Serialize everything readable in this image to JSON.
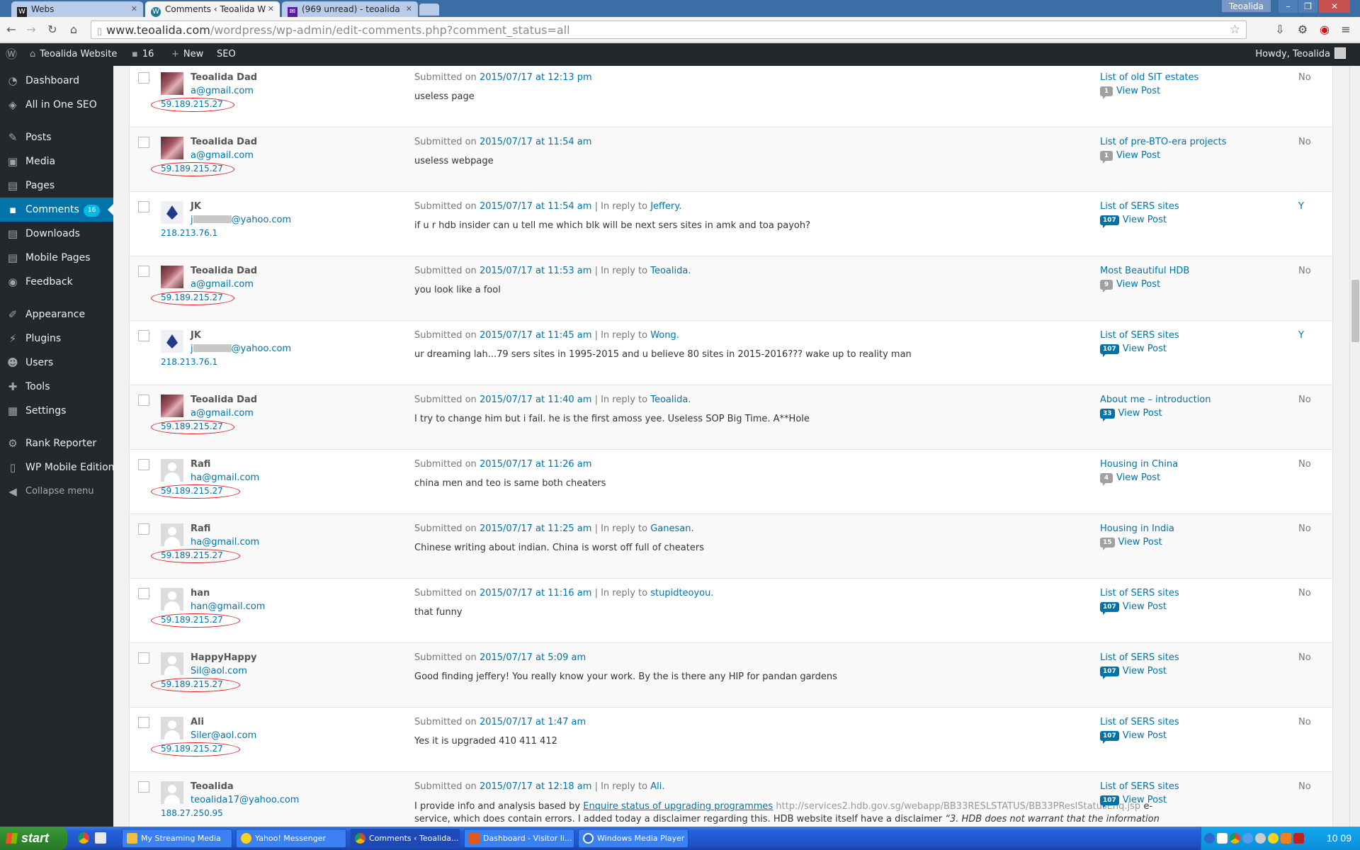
{
  "browser": {
    "tabs": [
      {
        "title": "Webs",
        "icon": "W"
      },
      {
        "title": "Comments ‹ Teoalida W",
        "icon": "wp"
      },
      {
        "title": "(969 unread) - teoalida",
        "icon": "yahoo"
      }
    ],
    "window_user": "Teoalida",
    "url_host": "www.teoalida.com",
    "url_path": "/wordpress/wp-admin/edit-comments.php?comment_status=all"
  },
  "adminbar": {
    "site_name": "Teoalida Website",
    "comments_count": "16",
    "new_label": "New",
    "seo_label": "SEO",
    "howdy": "Howdy, Teoalida"
  },
  "menu": {
    "dashboard": "Dashboard",
    "aioseo": "All in One SEO",
    "posts": "Posts",
    "media": "Media",
    "pages": "Pages",
    "comments": "Comments",
    "comments_badge": "16",
    "downloads": "Downloads",
    "mobile_pages": "Mobile Pages",
    "feedback": "Feedback",
    "appearance": "Appearance",
    "plugins": "Plugins",
    "users": "Users",
    "tools": "Tools",
    "settings": "Settings",
    "rank_reporter": "Rank Reporter",
    "wp_mobile": "WP Mobile Edition",
    "collapse": "Collapse menu"
  },
  "labels": {
    "submitted_on": "Submitted on",
    "in_reply_to": "| In reply to",
    "view_post": "View Post"
  },
  "comments": [
    {
      "author": "Teoalida Dad",
      "email": "a@gmail.com",
      "ip": "59.189.215.27",
      "date": "2015/07/17 at 12:13 pm",
      "reply_to": "",
      "text": "useless page",
      "post": "List of old SIT estates",
      "count": "1",
      "flag": "No"
    },
    {
      "author": "Teoalida Dad",
      "email": "a@gmail.com",
      "ip": "59.189.215.27",
      "date": "2015/07/17 at 11:54 am",
      "reply_to": "",
      "text": "useless webpage",
      "post": "List of pre-BTO-era projects",
      "count": "1",
      "flag": "No"
    },
    {
      "author": "JK",
      "email": "@yahoo.com",
      "email_prefix": "j",
      "ip": "218.213.76.1",
      "date": "2015/07/17 at 11:54 am",
      "reply_to": "Jeffery.",
      "text": "if u r hdb insider can u tell me which blk will be next sers sites in amk and toa payoh?",
      "post": "List of SERS sites",
      "count": "107",
      "flag": "Y"
    },
    {
      "author": "Teoalida Dad",
      "email": "a@gmail.com",
      "ip": "59.189.215.27",
      "date": "2015/07/17 at 11:53 am",
      "reply_to": "Teoalida.",
      "text": "you look like a fool",
      "post": "Most Beautiful HDB",
      "count": "9",
      "flag": "No"
    },
    {
      "author": "JK",
      "email": "@yahoo.com",
      "email_prefix": "j",
      "ip": "218.213.76.1",
      "date": "2015/07/17 at 11:45 am",
      "reply_to": "Wong.",
      "text": "ur dreaming lah...79 sers sites in 1995-2015 and u believe 80 sites in 2015-2016??? wake up to reality man",
      "post": "List of SERS sites",
      "count": "107",
      "flag": "Y"
    },
    {
      "author": "Teoalida Dad",
      "email": "a@gmail.com",
      "ip": "59.189.215.27",
      "date": "2015/07/17 at 11:40 am",
      "reply_to": "Teoalida.",
      "text": "I try to change him but i fail. he is the first amoss yee. Useless SOP Big Time. A**Hole",
      "post": "About me – introduction",
      "count": "33",
      "flag": "No"
    },
    {
      "author": "Rafi",
      "email": "ha@gmail.com",
      "ip": "59.189.215.27",
      "date": "2015/07/17 at 11:26 am",
      "reply_to": "",
      "text": "china men and teo is same both cheaters",
      "post": "Housing in China",
      "count": "4",
      "flag": "No"
    },
    {
      "author": "Rafi",
      "email": "ha@gmail.com",
      "ip": "59.189.215.27",
      "date": "2015/07/17 at 11:25 am",
      "reply_to": "Ganesan.",
      "text": "Chinese writing about indian. China is worst off full of cheaters",
      "post": "Housing in India",
      "count": "15",
      "flag": "No"
    },
    {
      "author": "han",
      "email": "han@gmail.com",
      "ip": "59.189.215.27",
      "date": "2015/07/17 at 11:16 am",
      "reply_to": "stupidteoyou.",
      "text": "that funny",
      "post": "List of SERS sites",
      "count": "107",
      "flag": "No"
    },
    {
      "author": "HappyHappy",
      "email": "Sil@aol.com",
      "ip": "59.189.215.27",
      "date": "2015/07/17 at 5:09 am",
      "reply_to": "",
      "text": "Good finding jeffery! You really know your work. By the is there any HIP for pandan gardens",
      "post": "List of SERS sites",
      "count": "107",
      "flag": "No"
    },
    {
      "author": "Ali",
      "email": "Siler@aol.com",
      "ip": "59.189.215.27",
      "date": "2015/07/17 at 1:47 am",
      "reply_to": "",
      "text": "Yes it is upgraded 410 411 412",
      "post": "List of SERS sites",
      "count": "107",
      "flag": "No"
    },
    {
      "author": "Teoalida",
      "email": "teoalida17@yahoo.com",
      "ip": "188.27.250.95",
      "date": "2015/07/17 at 12:18 am",
      "reply_to": "Ali.",
      "text": "",
      "post": "List of SERS sites",
      "count": "107",
      "flag": "No"
    }
  ],
  "last_comment": {
    "p1": "I provide info and analysis based by",
    "link": "Enquire status of upgrading programmes",
    "url": "http://services2.hdb.gov.sg/webapp/BB33RESLSTATUS/BB33PReslStatusEnq.jsp",
    "p2": "e-",
    "line2": "service, which does contain errors. I added today a disclaimer regarding this. HDB website itself have a disclaimer",
    "quote": "“3. HDB does not warrant that the information"
  },
  "taskbar": {
    "start": "start",
    "tasks": [
      "My Streaming Media",
      "Yahoo! Messenger",
      "Comments ‹ Teoalida...",
      "Dashboard - Visitor li...",
      "Windows Media Player"
    ],
    "clock": "10 09"
  }
}
